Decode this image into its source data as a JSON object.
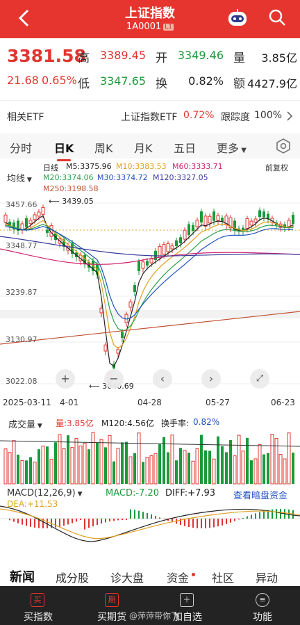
{
  "header": {
    "title": "上证指数",
    "code": "1A0001",
    "level_tag": "L1"
  },
  "quote": {
    "price": "3381.58",
    "change": "21.68",
    "change_pct": "0.65%",
    "high_label": "高",
    "high": "3389.45",
    "low_label": "低",
    "low": "3347.65",
    "open_label": "开",
    "open": "3349.46",
    "turnover_label": "换",
    "turnover": "0.82%",
    "volume_label": "量",
    "volume": "3.85亿",
    "amount_label": "额",
    "amount": "4427.9亿"
  },
  "etf": {
    "label": "相关ETF",
    "name": "上证指数ETF",
    "pct": "0.72%",
    "track_label": "跟踪度",
    "track_value": "100%"
  },
  "tabs": [
    "分时",
    "日K",
    "周K",
    "月K",
    "五日",
    "更多"
  ],
  "active_tab": "日K",
  "kline": {
    "ma_selector": "均线",
    "period": "日线",
    "ma5": "M5:3375.96",
    "ma10": "M10:3383.53",
    "ma60": "M60:3333.71",
    "ma20": "M20:3374.06",
    "ma30": "M30:3374.72",
    "ma120": "M120:3327.05",
    "ma250": "M250:3198.58",
    "adjust": "前复权",
    "yticks": [
      "3457.66",
      "3348.77",
      "3239.87",
      "3130.97",
      "3022.08"
    ],
    "high_mark": "3439.05",
    "low_mark": "3040.69",
    "dates": [
      "2025-03-11",
      "4-01",
      "04-28",
      "05-27",
      "06-23"
    ]
  },
  "volume": {
    "selector": "成交量",
    "vol": "量:3.85亿",
    "m120": "M120:4.56亿",
    "turnover": "换手率:",
    "turnover_val": "0.82%"
  },
  "macd": {
    "selector": "MACD(12,26,9)",
    "macd": "MACD:-7.20",
    "diff": "DIFF:+7.93",
    "dea": "DEA:+11.53",
    "link": "查看暗盘资金"
  },
  "bottom_tabs": [
    "新闻",
    "成分股",
    "诊大盘",
    "资金",
    "社区",
    "异动"
  ],
  "actions": [
    {
      "label": "买指数",
      "icon": "买"
    },
    {
      "label": "买期货",
      "icon": "期"
    },
    {
      "label": "加自选",
      "icon": "＋"
    },
    {
      "label": "功能",
      "icon": "≡"
    }
  ],
  "watermark": "@萍萍带你飞",
  "colors": {
    "brand_red": "#e6352f",
    "up": "#e0352f",
    "down": "#1a9a3a",
    "ma5": "#222222",
    "ma10": "#e0a020",
    "ma20": "#2aa04a",
    "ma30": "#2050c0",
    "ma60": "#d02070",
    "ma120": "#3a3a9a",
    "ma250": "#c05030"
  }
}
